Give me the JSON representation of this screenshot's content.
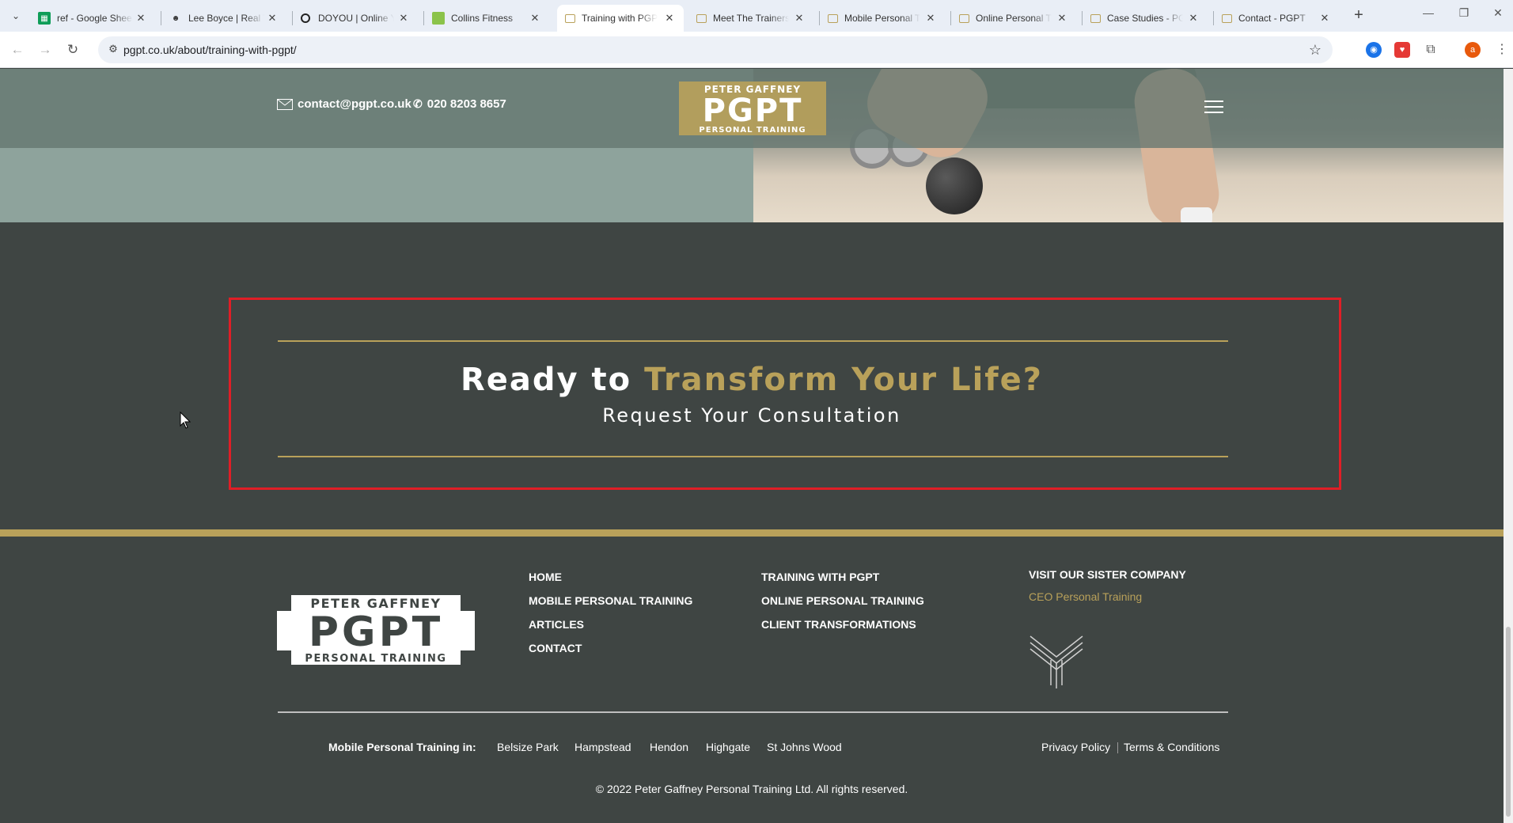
{
  "browser": {
    "tabs": [
      {
        "title": "ref - Google Shee",
        "favicon": "sheets-icon",
        "color": "#0f9d58"
      },
      {
        "title": "Lee Boyce | Real T",
        "favicon": "person-icon",
        "color": "#444444"
      },
      {
        "title": "DOYOU | Online Y",
        "favicon": "ring-icon",
        "color": "#222222"
      },
      {
        "title": "Collins Fitness",
        "favicon": "square-icon",
        "color": "#8bc34a"
      },
      {
        "title": "Training with PGP",
        "favicon": "page-icon",
        "color": "#b9a15a",
        "active": true
      },
      {
        "title": "Meet The Trainers",
        "favicon": "page-icon",
        "color": "#b9a15a"
      },
      {
        "title": "Mobile Personal T",
        "favicon": "page-icon",
        "color": "#b9a15a"
      },
      {
        "title": "Online Personal Tr",
        "favicon": "page-icon",
        "color": "#b9a15a"
      },
      {
        "title": "Case Studies - PG",
        "favicon": "page-icon",
        "color": "#b9a15a"
      },
      {
        "title": "Contact - PGPT",
        "favicon": "page-icon",
        "color": "#b9a15a"
      }
    ],
    "url": "pgpt.co.uk/about/training-with-pgpt/",
    "profile_initial": "a"
  },
  "header": {
    "email": "contact@pgpt.co.uk",
    "phone": "020 8203 8657",
    "logo": {
      "top": "PETER GAFFNEY",
      "main": "PGPT",
      "bottom": "PERSONAL TRAINING"
    }
  },
  "cta": {
    "title_white": "Ready to ",
    "title_gold": "Transform Your Life?",
    "subtitle": "Request Your Consultation"
  },
  "footer": {
    "logo": {
      "top": "PETER GAFFNEY",
      "main": "PGPT",
      "bottom": "PERSONAL TRAINING"
    },
    "col1": [
      "HOME",
      "MOBILE PERSONAL TRAINING",
      "ARTICLES",
      "CONTACT"
    ],
    "col2": [
      "TRAINING WITH PGPT",
      "ONLINE PERSONAL TRAINING",
      "CLIENT TRANSFORMATIONS"
    ],
    "sister_heading": "VISIT OUR SISTER COMPANY",
    "sister_link": "CEO Personal Training",
    "areas_label": "Mobile Personal Training in:",
    "areas": [
      "Belsize Park",
      "Hampstead",
      "Hendon",
      "Highgate",
      "St Johns Wood"
    ],
    "legal": [
      "Privacy Policy",
      "Terms & Conditions"
    ],
    "copyright": "© 2022 Peter Gaffney Personal Training Ltd. All rights reserved."
  },
  "colors": {
    "gold": "#b9a15a",
    "dark_bg": "#3f4543",
    "highlight_border": "#e01e26"
  }
}
